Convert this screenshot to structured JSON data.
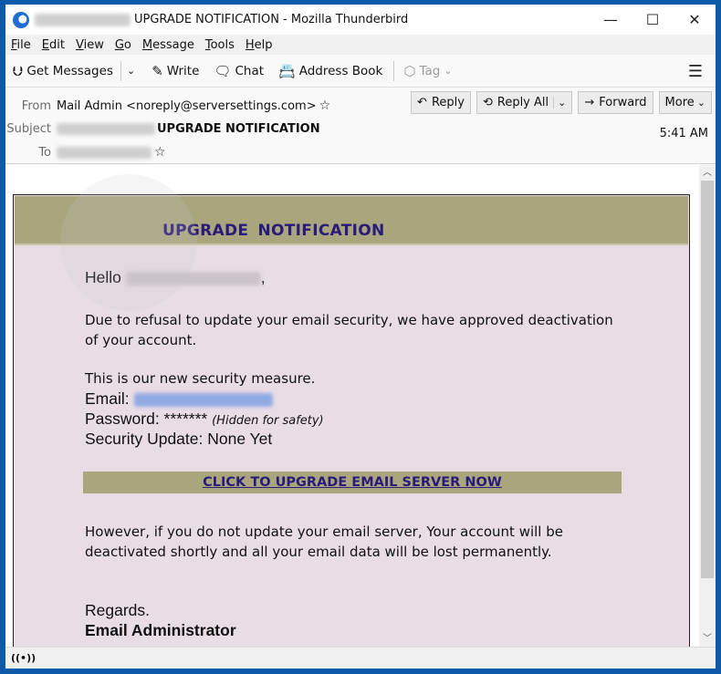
{
  "window": {
    "title_prefix_redacted": true,
    "title": "UPGRADE NOTIFICATION - Mozilla Thunderbird",
    "controls": {
      "minimize": "—",
      "maximize": "☐",
      "close": "✕"
    }
  },
  "menubar": {
    "items": [
      {
        "acc": "F",
        "rest": "ile"
      },
      {
        "acc": "E",
        "rest": "dit"
      },
      {
        "acc": "V",
        "rest": "iew"
      },
      {
        "acc": "G",
        "rest": "o"
      },
      {
        "acc": "M",
        "rest": "essage"
      },
      {
        "acc": "T",
        "rest": "ools"
      },
      {
        "acc": "H",
        "rest": "elp"
      }
    ]
  },
  "toolbar": {
    "get_messages": "Get Messages",
    "write": "Write",
    "chat": "Chat",
    "address_book": "Address Book",
    "tag": "Tag",
    "icons": {
      "get_messages": "⮋",
      "write": "✎",
      "chat": "🗨",
      "address_book": "📇",
      "tag": "⬡",
      "dropdown": "⌄",
      "menu": "☰"
    }
  },
  "header": {
    "from_label": "From",
    "from_value": "Mail Admin <noreply@serversettings.com>",
    "subject_label": "Subject",
    "subject_value": "UPGRADE NOTIFICATION",
    "to_label": "To",
    "time": "5:41 AM",
    "star": "☆",
    "actions": {
      "reply": "Reply",
      "reply_all": "Reply All",
      "forward": "Forward",
      "more": "More",
      "reply_icon": "↶",
      "reply_all_icon": "⟲",
      "forward_icon": "→",
      "dropdown": "⌄"
    }
  },
  "email": {
    "banner_title": "UPGRADE  NOTIFICATION",
    "greeting": "Hello",
    "greeting_suffix": ",",
    "paragraph1_line1": "Due to refusal to update your email security, we have approved deactivation",
    "paragraph1_line2": "of your account.",
    "measure": "This is our new security measure.",
    "email_label": "Email:",
    "password_label": "Password: *******",
    "password_hint": "(Hidden for safety)",
    "security_update": "Security Update: None Yet",
    "cta": "CLICK TO UPGRADE EMAIL SERVER NOW",
    "warning_line1": "However, if you do not update your email server, Your account will be",
    "warning_line2": "deactivated shortly and all your email data will be lost permanently.",
    "regards": "Regards.",
    "signature": "Email Administrator"
  },
  "scrollbar": {
    "up": "︿",
    "down": "﹀"
  },
  "statusbar": {
    "icon": "((•))"
  },
  "colors": {
    "banner": "#a9a67d",
    "banner_text": "#2a1a7a",
    "email_bg": "#e8dde4",
    "window_frame": "#0a5aa8"
  }
}
